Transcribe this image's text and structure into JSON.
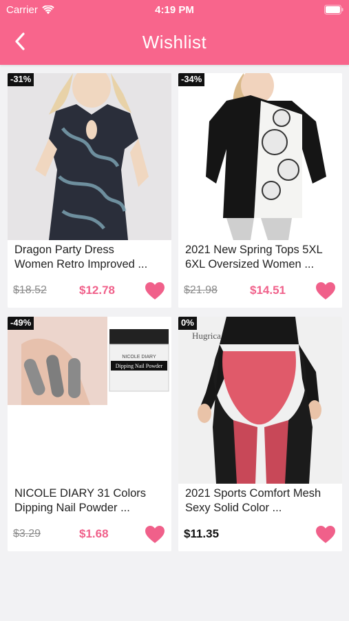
{
  "status_bar": {
    "carrier": "Carrier",
    "time": "4:19 PM"
  },
  "nav": {
    "title": "Wishlist"
  },
  "colors": {
    "header": "#f8658c",
    "accent_price": "#f0608a",
    "heart": "#f0608a",
    "background": "#f2f2f4"
  },
  "products": [
    {
      "discount": "-31%",
      "name": "Dragon Party Dress\nWomen Retro Improved ...",
      "original_price": "$18.52",
      "sale_price": "$12.78",
      "image_icon": "dress-photo-icon"
    },
    {
      "discount": "-34%",
      "name": "2021 New Spring Tops 5XL\n6XL Oversized Women ...",
      "original_price": "$21.98",
      "sale_price": "$14.51",
      "image_icon": "top-photo-icon"
    },
    {
      "discount": "-49%",
      "name": "NICOLE DIARY 31 Colors\nDipping Nail Powder ...",
      "original_price": "$3.29",
      "sale_price": "$1.68",
      "image_icon": "nail-powder-photo-icon",
      "image_text": [
        "NICOLE DIARY",
        "Dipping Nail Powder"
      ]
    },
    {
      "discount": "0%",
      "name": "2021 Sports Comfort Mesh\nSexy Solid Color ...",
      "price": "$11.35",
      "image_icon": "leggings-photo-icon",
      "image_text": [
        "Hugrica"
      ]
    }
  ]
}
